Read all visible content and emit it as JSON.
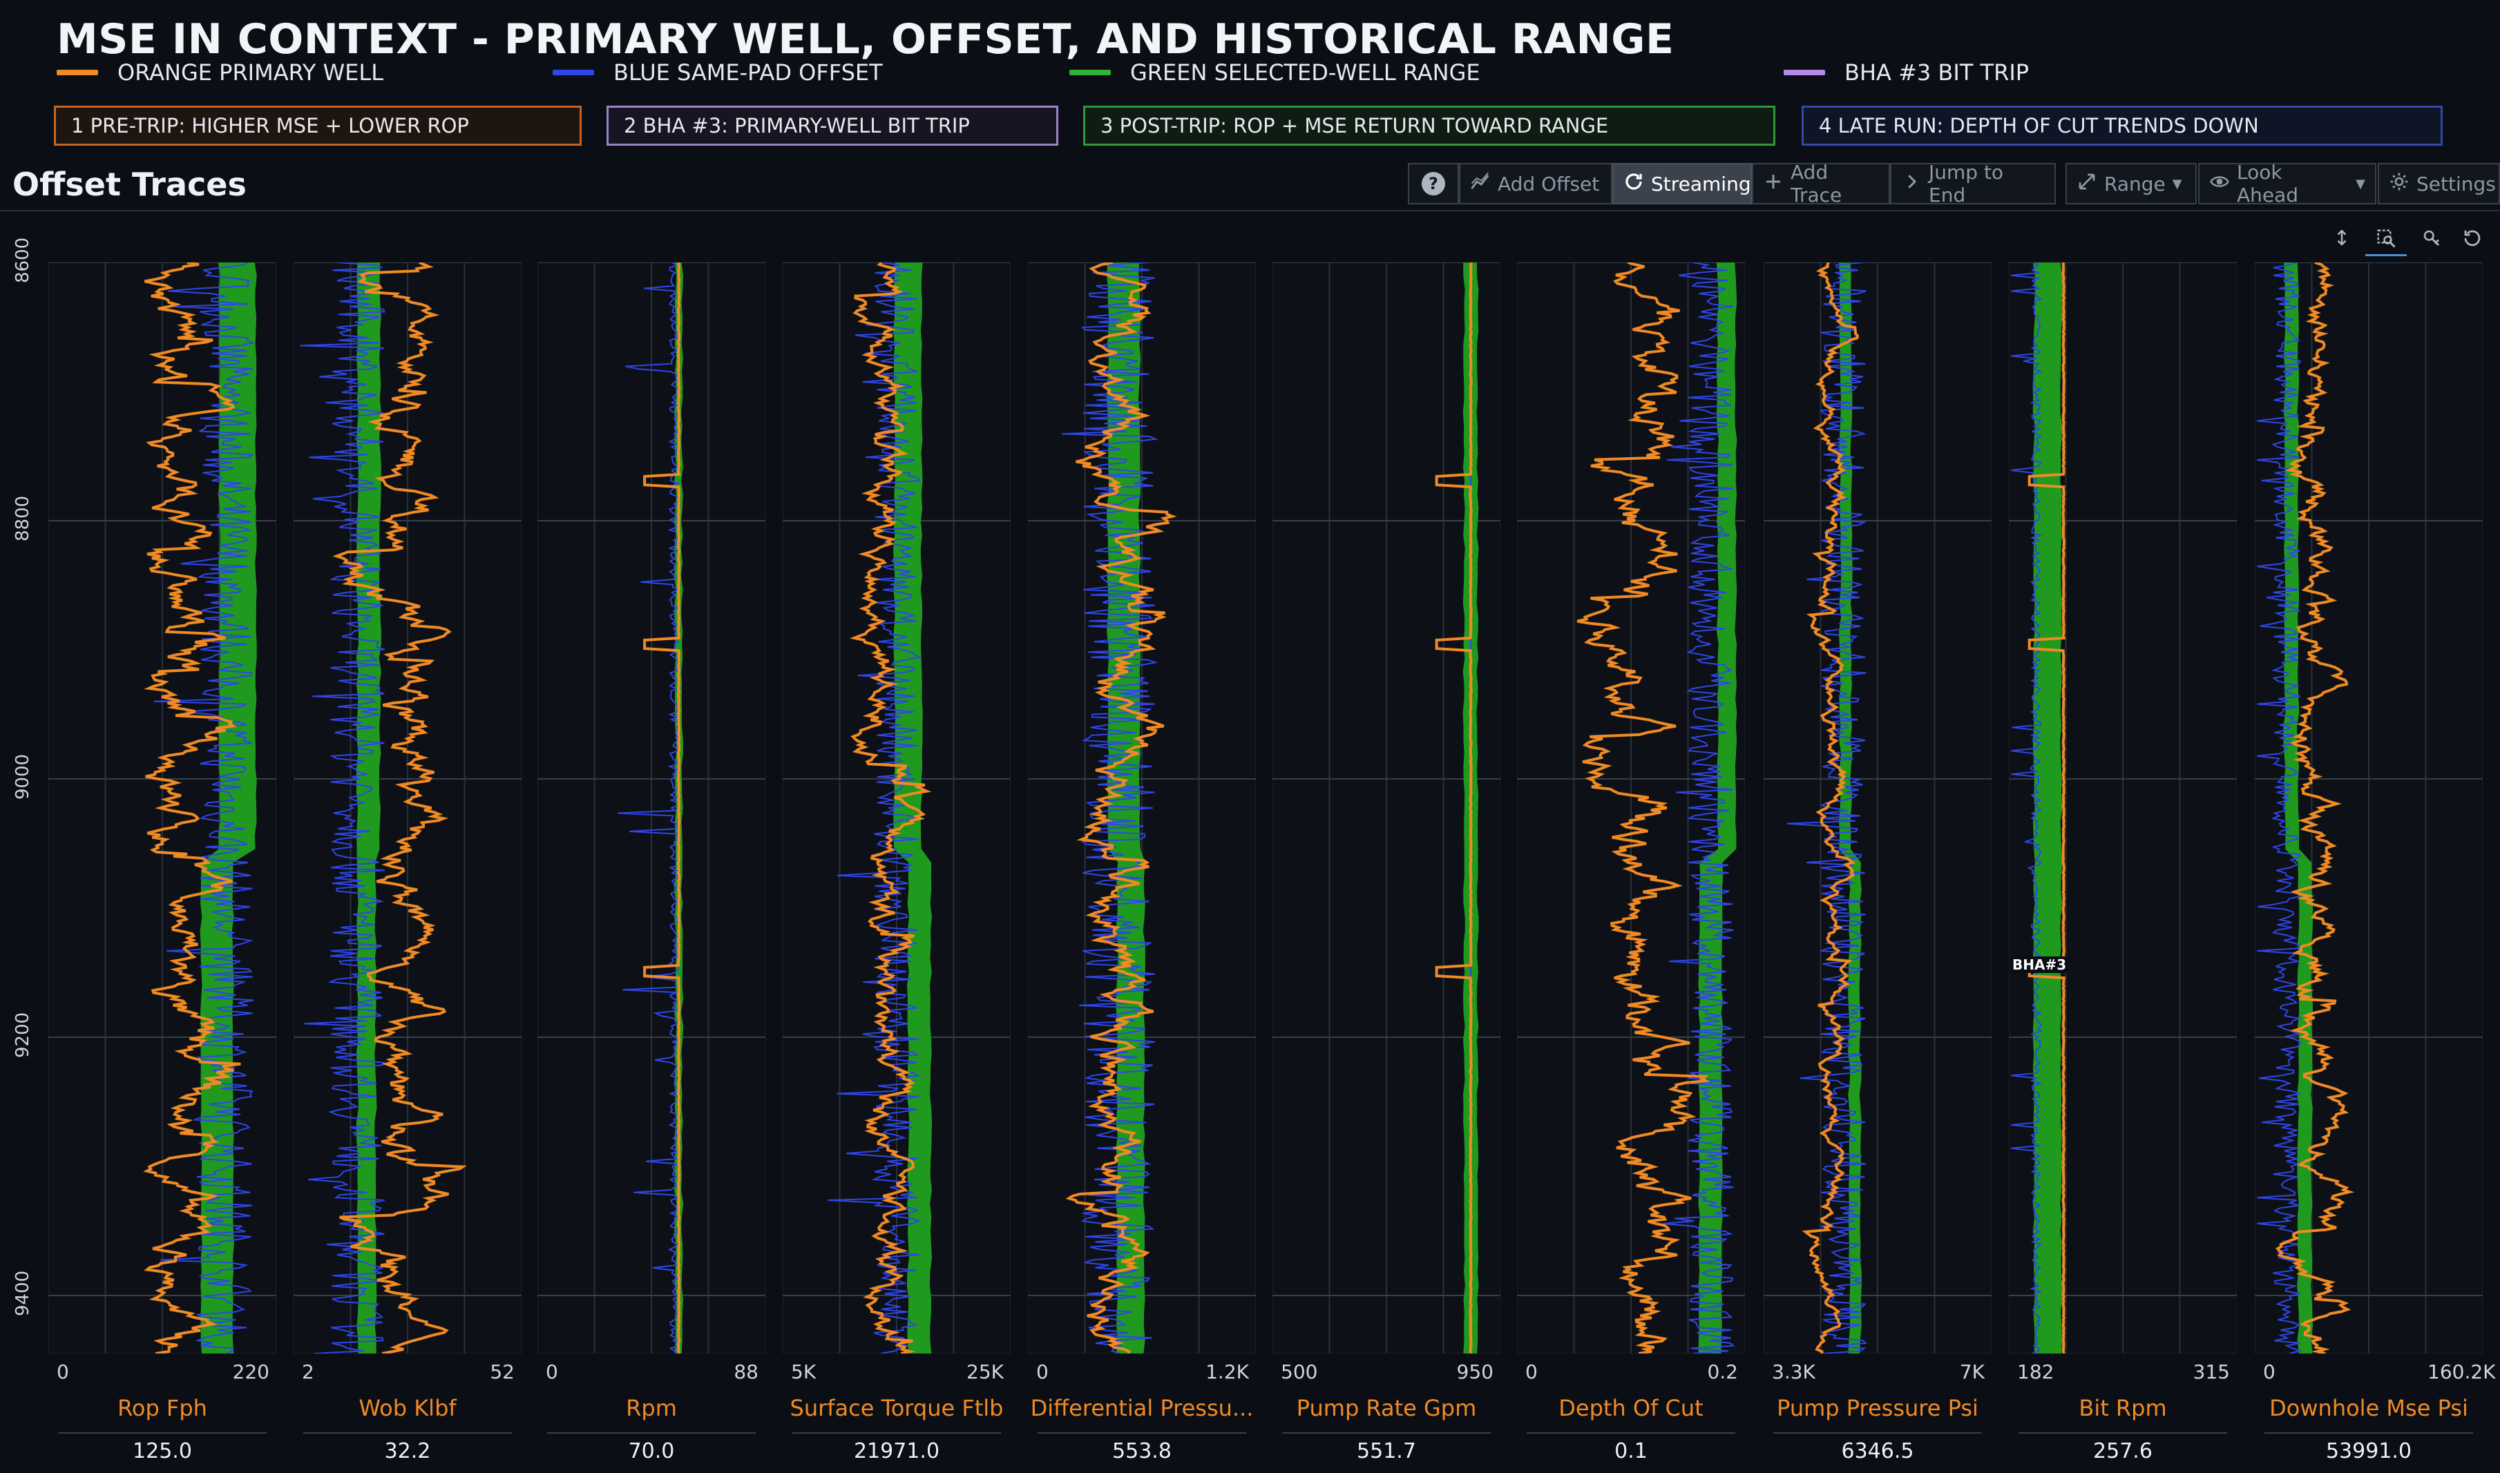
{
  "title": "MSE IN CONTEXT - PRIMARY WELL, OFFSET, AND HISTORICAL RANGE",
  "legend": [
    {
      "label": "ORANGE  PRIMARY WELL",
      "color": "#f08a24"
    },
    {
      "label": "BLUE  SAME-PAD OFFSET",
      "color": "#2f46e8"
    },
    {
      "label": "GREEN  SELECTED-WELL RANGE",
      "color": "#2fb533"
    },
    {
      "label": "BHA #3  BIT TRIP",
      "color": "#b38be8"
    }
  ],
  "steps": [
    {
      "label": "1  PRE-TRIP: HIGHER MSE + LOWER ROP",
      "color": "#c8631d"
    },
    {
      "label": "2  BHA #3: PRIMARY-WELL BIT TRIP",
      "color": "#9a84c9"
    },
    {
      "label": "3  POST-TRIP: ROP + MSE RETURN TOWARD RANGE",
      "color": "#2c9a38"
    },
    {
      "label": "4  LATE RUN: DEPTH OF CUT TRENDS DOWN",
      "color": "#3149a8"
    }
  ],
  "section_title": "Offset Traces",
  "toolbar": {
    "help": "?",
    "add_offset": "Add Offset",
    "streaming": "Streaming",
    "add_trace": "Add Trace",
    "jump_to_end": "Jump to End",
    "range": "Range",
    "look_ahead": "Look Ahead",
    "settings": "Settings"
  },
  "depth_axis": {
    "ticks": [
      "8600",
      "8800",
      "9000",
      "9200",
      "9400"
    ],
    "min": 8600,
    "max": 9445
  },
  "bha_marker": {
    "label": "BHA#3",
    "depth": 9145
  },
  "tracks": [
    {
      "name": "Rop Fph",
      "min": "0",
      "max": "220",
      "value": "125.0"
    },
    {
      "name": "Wob Klbf",
      "min": "2",
      "max": "52",
      "value": "32.2"
    },
    {
      "name": "Rpm",
      "min": "0",
      "max": "88",
      "value": "70.0"
    },
    {
      "name": "Surface Torque Ftlb",
      "min": "5K",
      "max": "25K",
      "value": "21971.0"
    },
    {
      "name": "Differential Pressu...",
      "min": "0",
      "max": "1.2K",
      "value": "553.8"
    },
    {
      "name": "Pump Rate Gpm",
      "min": "500",
      "max": "950",
      "value": "551.7"
    },
    {
      "name": "Depth Of Cut",
      "min": "0",
      "max": "0.2",
      "value": "0.1"
    },
    {
      "name": "Pump Pressure Psi",
      "min": "3.3K",
      "max": "7K",
      "value": "6346.5"
    },
    {
      "name": "Bit Rpm",
      "min": "182",
      "max": "315",
      "value": "257.6"
    },
    {
      "name": "Downhole Mse Psi",
      "min": "0",
      "max": "160.2K",
      "value": "53991.0"
    }
  ]
}
